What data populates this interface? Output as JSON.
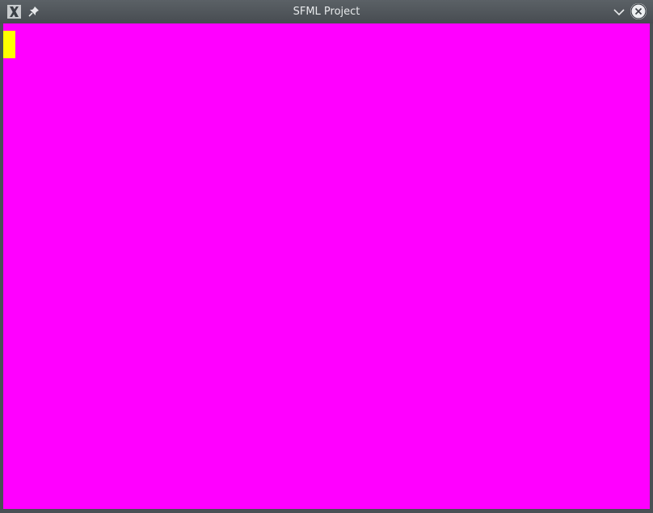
{
  "window": {
    "title": "SFML Project",
    "app_icon": "x11-app-icon",
    "pin_icon": "pin-icon",
    "minimize_icon": "chevron-down-icon",
    "close_icon": "close-icon"
  },
  "canvas": {
    "background_color": "#ff00ff",
    "sprite_color": "#ffff00"
  }
}
